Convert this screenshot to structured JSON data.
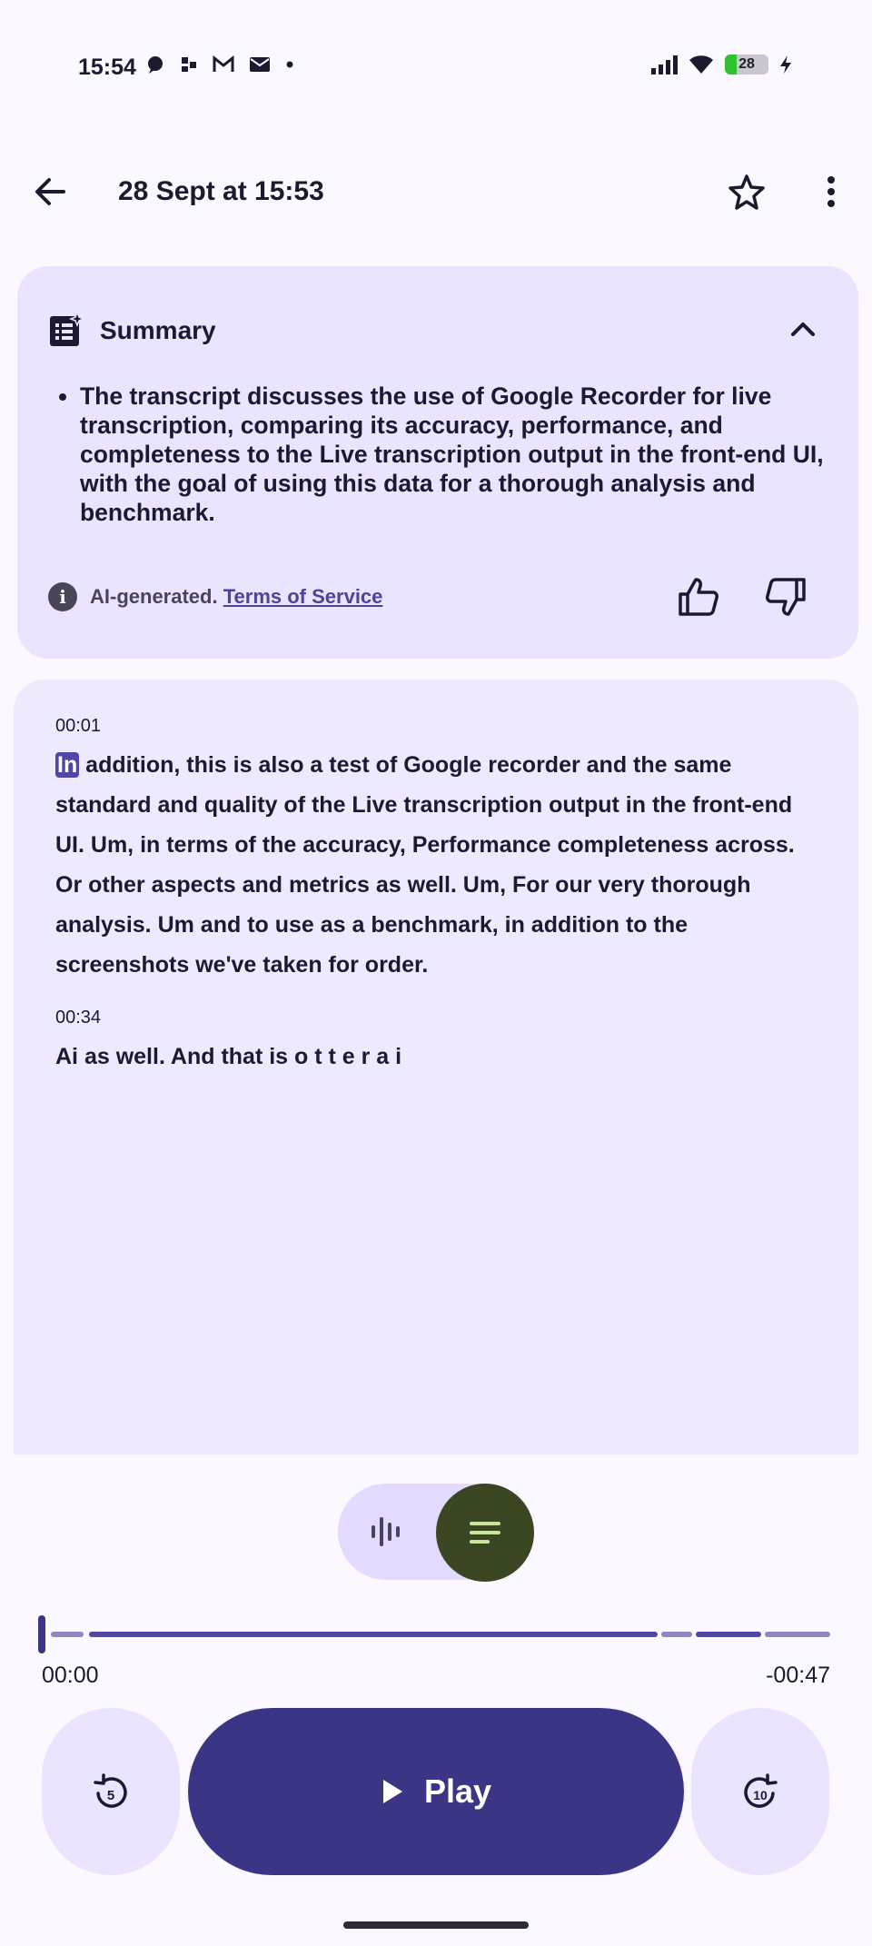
{
  "status_bar": {
    "time": "15:54",
    "battery": "28"
  },
  "header": {
    "title": "28 Sept at 15:53"
  },
  "summary": {
    "title": "Summary",
    "bullets": [
      "The transcript discusses the use of Google Recorder for live transcription, comparing its accuracy, performance, and completeness to the Live transcription output in the front-end UI, with the goal of using this data for a thorough analysis and benchmark."
    ],
    "ai_note": "AI-generated.",
    "terms_link": "Terms of Service"
  },
  "transcript": {
    "segments": [
      {
        "time": "00:01",
        "highlight": "In",
        "text": " addition, this is also a test of Google recorder and the same standard and quality of the Live transcription output in the front-end UI. Um, in terms of the accuracy, Performance completeness across. Or other aspects and metrics as well. Um, For our very thorough analysis. Um and to use as a benchmark, in addition to the screenshots we've taken for order."
      },
      {
        "time": "00:34",
        "text": "Ai as well. And that is o t t e r a i"
      }
    ]
  },
  "player": {
    "elapsed": "00:00",
    "remaining": "-00:47",
    "progress": 0,
    "play_label": "Play",
    "rewind_seconds": "5",
    "forward_seconds": "10"
  },
  "colors": {
    "accent": "#3A3584",
    "summary_bg": "#EAE4FF",
    "transcript_bg": "#EFE9FD",
    "toggle_active": "#3A4722"
  }
}
